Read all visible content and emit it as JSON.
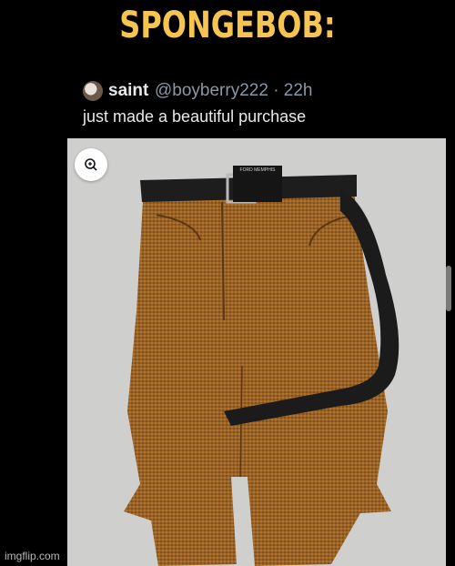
{
  "meme": {
    "caption": "SPONGEBOB:",
    "watermark": "imgflip.com"
  },
  "tweet": {
    "display_name": "saint",
    "handle_time": "@boyberry222 · 22h",
    "text": "just made a beautiful purchase",
    "avatar_icon": "profile-avatar",
    "photo": {
      "zoom_icon": "zoom-in-icon",
      "belt_brand_label": "FORD MEMPHIS"
    }
  },
  "colors": {
    "caption": "#f5c451",
    "tweet_text": "#e7e9ea",
    "handle": "#8b98a5",
    "fabric": "#9a6125",
    "background": "#cfcfcd"
  }
}
